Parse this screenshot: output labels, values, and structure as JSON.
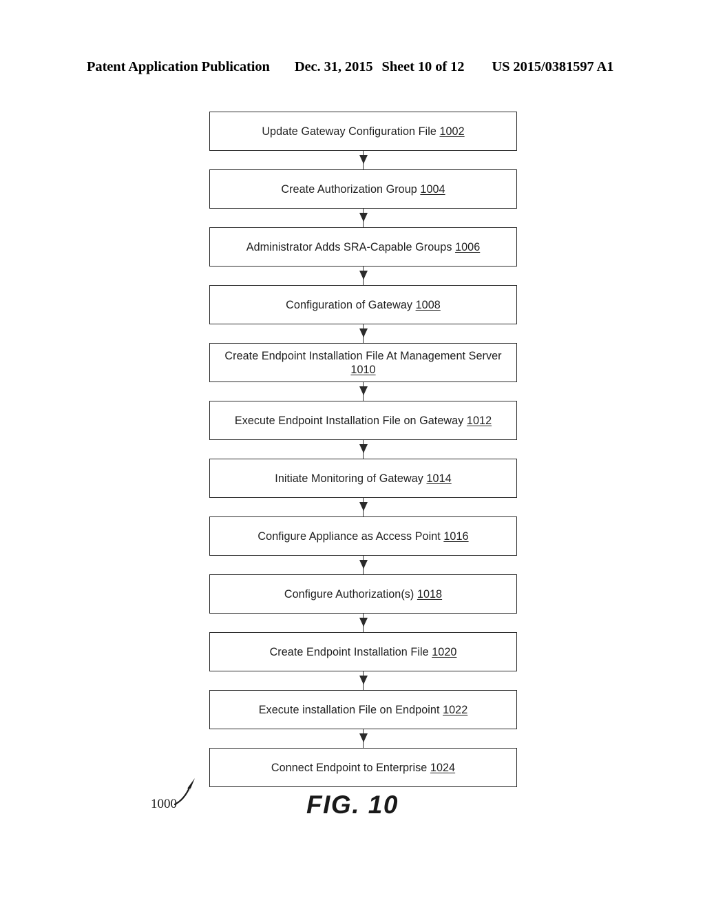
{
  "header": {
    "publication": "Patent Application Publication",
    "date": "Dec. 31, 2015",
    "sheet": "Sheet 10 of 12",
    "patent_number": "US 2015/0381597 A1"
  },
  "figure": {
    "label": "FIG. 10",
    "lead_reference": "1000",
    "lead_arrow_icon": "curved-arrow-up-right-icon"
  },
  "flowchart": {
    "type": "linear-process-flow",
    "arrow_icon": "arrow-down-icon",
    "steps": [
      {
        "text": "Update Gateway Configuration File ",
        "ref": "1002",
        "lines": 1
      },
      {
        "text": "Create Authorization Group ",
        "ref": "1004",
        "lines": 1
      },
      {
        "text": "Administrator Adds SRA-Capable Groups ",
        "ref": "1006",
        "lines": 1
      },
      {
        "text": "Configuration of Gateway ",
        "ref": "1008",
        "lines": 1
      },
      {
        "text": "Create Endpoint Installation File At Management Server ",
        "ref": "1010",
        "lines": 2
      },
      {
        "text": "Execute Endpoint Installation File on Gateway ",
        "ref": "1012",
        "lines": 1
      },
      {
        "text": "Initiate Monitoring of Gateway ",
        "ref": "1014",
        "lines": 1
      },
      {
        "text": "Configure Appliance as Access Point ",
        "ref": "1016",
        "lines": 1
      },
      {
        "text": "Configure Authorization(s) ",
        "ref": "1018",
        "lines": 1
      },
      {
        "text": "Create Endpoint Installation File ",
        "ref": "1020",
        "lines": 1
      },
      {
        "text": "Execute installation File on Endpoint ",
        "ref": "1022",
        "lines": 1
      },
      {
        "text": "Connect Endpoint to Enterprise ",
        "ref": "1024",
        "lines": 1
      }
    ]
  },
  "colors": {
    "line": "#2b2b2b",
    "text": "#1f1f1f",
    "background": "#ffffff"
  }
}
